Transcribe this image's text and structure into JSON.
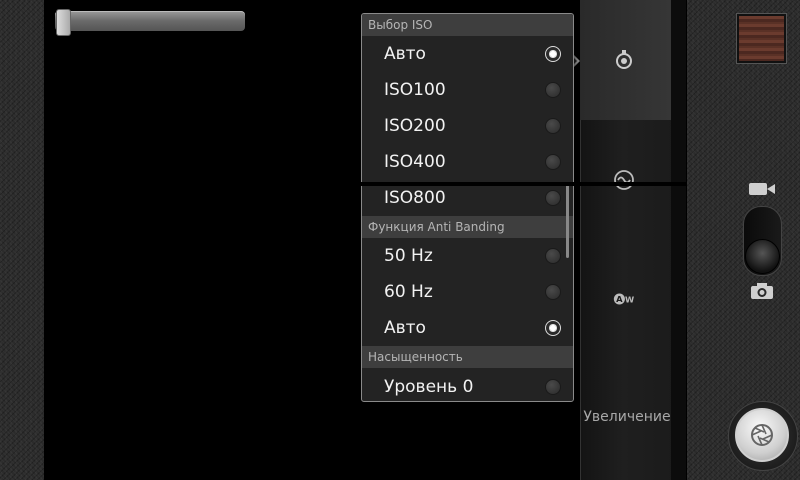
{
  "settings_panel": {
    "zoom_label": "Увеличение",
    "icons": [
      "iso-icon",
      "anti-banding-icon",
      "auto-white-balance-icon"
    ]
  },
  "zoom_slider": {
    "level": 0
  },
  "iso_popup": {
    "sections": [
      {
        "header": "Выбор ISO",
        "options": [
          {
            "label": "Авто",
            "selected": true
          },
          {
            "label": "ISO100",
            "selected": false
          },
          {
            "label": "ISO200",
            "selected": false
          },
          {
            "label": "ISO400",
            "selected": false
          },
          {
            "label": "ISO800",
            "selected": false
          }
        ]
      },
      {
        "header": "Функция Anti Banding",
        "options": [
          {
            "label": "50 Hz",
            "selected": false
          },
          {
            "label": "60 Hz",
            "selected": false
          },
          {
            "label": "Авто",
            "selected": true
          }
        ]
      },
      {
        "header": "Насыщенность",
        "options": [
          {
            "label": "Уровень 0",
            "selected": false
          }
        ]
      }
    ]
  },
  "right_controls": {
    "video_mode_icon": "video-camera-icon",
    "photo_mode_icon": "camera-icon",
    "mode": "photo",
    "shutter_icon": "aperture-icon"
  },
  "colors": {
    "popup_bg": "#232323",
    "section_header_bg": "#3e3e3e",
    "accent_text": "#f2f2f2"
  }
}
